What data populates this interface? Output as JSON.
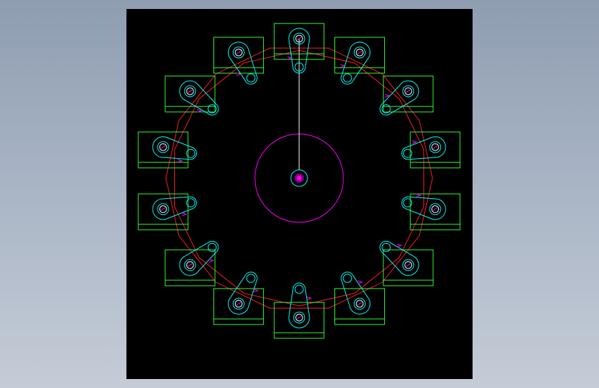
{
  "colors": {
    "background_top": "#8f9db1",
    "background_bottom": "#c5ccd7",
    "viewport": "#000000",
    "link_outline": "#00ffff",
    "block_outline": "#33ff33",
    "chain_polygon": "#ff2020",
    "center_marks": "#ff00ff",
    "hole_outline": "#ffffff"
  },
  "icons": {
    "link_hole": "circle",
    "center_mark": "asterisk",
    "direction_marker": "arrowhead"
  },
  "mechanism": {
    "link_count": 14,
    "block_count": 14
  }
}
